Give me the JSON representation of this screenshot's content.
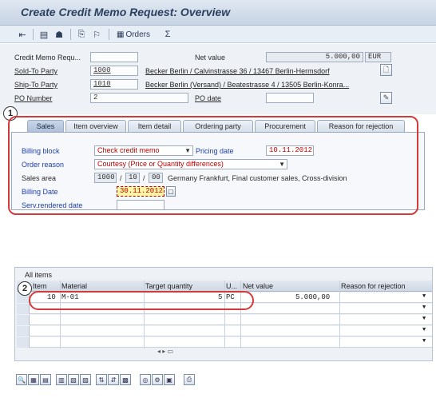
{
  "window": {
    "title": "Create Credit Memo Request: Overview"
  },
  "toolbar": {
    "orders_label": "Orders"
  },
  "header": {
    "credit_memo_label": "Credit Memo Requ...",
    "credit_memo_value": "",
    "net_value_label": "Net value",
    "net_value": "5.000,00",
    "currency": "EUR",
    "sold_to_label": "Sold-To Party",
    "sold_to_value": "1000",
    "sold_to_desc": "Becker Berlin / Calvinstrasse 36 / 13467 Berlin-Hermsdorf",
    "ship_to_label": "Ship-To Party",
    "ship_to_value": "1010",
    "ship_to_desc": "Becker Berlin (Versand) / Beatestrasse 4 / 13505 Berlin-Konra...",
    "po_number_label": "PO Number",
    "po_number_value": "2",
    "po_date_label": "PO date",
    "po_date_value": ""
  },
  "tabs": [
    {
      "label": "Sales"
    },
    {
      "label": "Item overview"
    },
    {
      "label": "Item detail"
    },
    {
      "label": "Ordering party"
    },
    {
      "label": "Procurement"
    },
    {
      "label": "Reason for rejection"
    }
  ],
  "sales": {
    "billing_block_label": "Billing block",
    "billing_block_value": "Check credit memo",
    "pricing_date_label": "Pricing date",
    "pricing_date_value": "10.11.2012",
    "order_reason_label": "Order reason",
    "order_reason_value": "Courtesy (Price or Quantity differences)",
    "sales_area_label": "Sales area",
    "sales_org": "1000",
    "dist_channel": "10",
    "division": "00",
    "sales_area_desc": "Germany Frankfurt, Final customer sales, Cross-division",
    "billing_date_label": "Billing Date",
    "billing_date_value": "30.11.2012",
    "serv_rendered_label": "Serv.rendered date",
    "serv_rendered_value": ""
  },
  "items": {
    "title": "All items",
    "columns": [
      "Item",
      "Material",
      "Target quantity",
      "U...",
      "Net value",
      "Reason for rejection"
    ],
    "rows": [
      {
        "item": "10",
        "material": "M-01",
        "qty": "5",
        "unit": "PC",
        "net": "5.000,00"
      }
    ]
  },
  "callouts": [
    "1",
    "2"
  ],
  "colors": {
    "callout": "#d33b3b",
    "required_text": "#c00000",
    "label_blue": "#1d3fa8"
  }
}
